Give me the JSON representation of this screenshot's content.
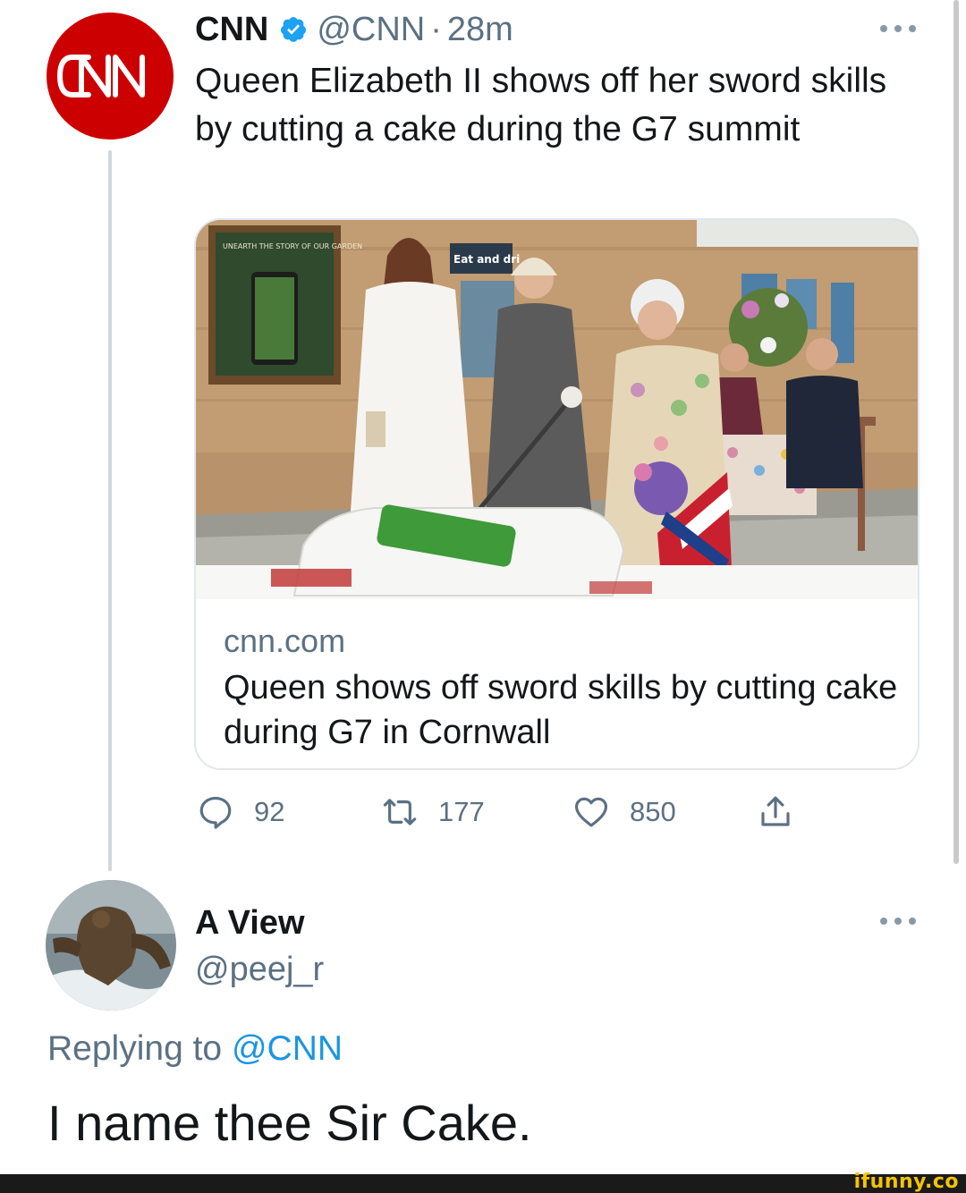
{
  "tweet": {
    "author_name": "CNN",
    "author_handle": "@CNN",
    "separator": "·",
    "time": "28m",
    "avatar_logo_text": "CNN",
    "text": "Queen Elizabeth II shows off her sword skills by cutting a cake during the G7 summit",
    "card": {
      "domain": "cnn.com",
      "title": "Queen shows off sword skills by cutting cake during G7 in Cornwall",
      "image_sign_text": "Eat and dri",
      "image_poster_text": "UNEARTH THE STORY OF OUR GARDEN"
    },
    "actions": {
      "replies": "92",
      "retweets": "177",
      "likes": "850"
    }
  },
  "reply": {
    "author_name": "A View",
    "author_handle": "@peej_r",
    "replying_prefix": "Replying to ",
    "replying_to": "@CNN",
    "text": "I name thee Sir Cake."
  },
  "watermark": "ifunny.co",
  "colors": {
    "cnn_red": "#cc0000",
    "verified_blue": "#1da1f2",
    "secondary_text": "#5b7083",
    "mention_blue": "#1b95e0",
    "watermark_yellow": "#f5c400"
  },
  "icons": {
    "reply": "comment-bubble-icon",
    "retweet": "retweet-icon",
    "like": "heart-icon",
    "share": "share-icon",
    "verified": "verified-badge-icon",
    "more": "more-dots-icon"
  }
}
